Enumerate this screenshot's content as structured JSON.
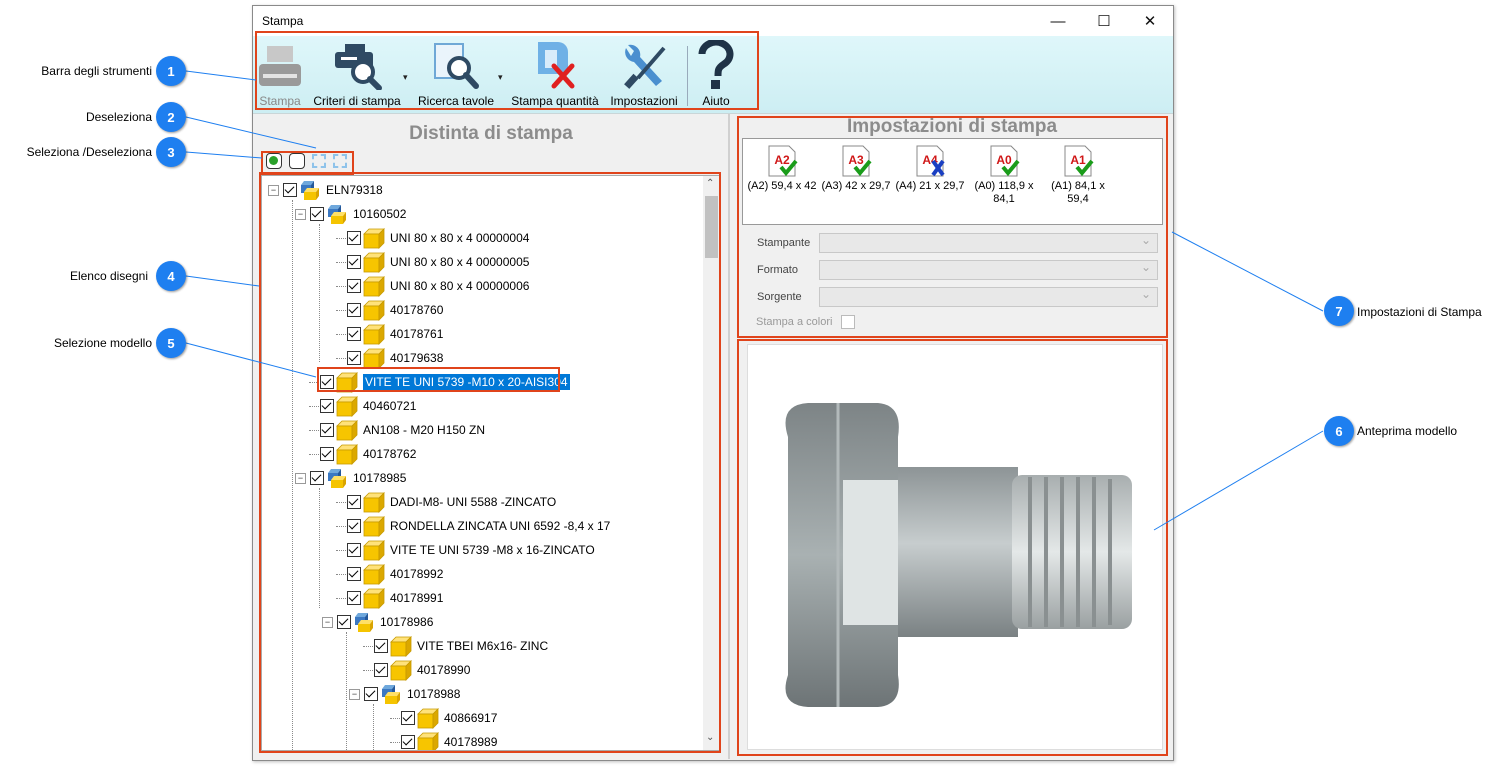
{
  "window": {
    "title": "Stampa",
    "minimize": "—",
    "maximize": "☐",
    "close": "✕"
  },
  "toolbar": {
    "print_label": "Stampa",
    "criteria_label": "Criteri di stampa",
    "search_label": "Ricerca tavole",
    "quantity_label": "Stampa quantità",
    "settings_label": "Impostazioni",
    "help_label": "Aiuto",
    "caret": "▾"
  },
  "left_panel": {
    "title": "Distinta di stampa"
  },
  "tree": {
    "items": [
      {
        "label": "ELN79318",
        "level": 0,
        "type": "assembly",
        "expander": "−"
      },
      {
        "label": "10160502",
        "level": 1,
        "type": "assembly",
        "expander": "−"
      },
      {
        "label": "UNI 80 x 80 x 4 00000004",
        "level": 2,
        "type": "part"
      },
      {
        "label": "UNI 80 x 80 x 4 00000005",
        "level": 2,
        "type": "part"
      },
      {
        "label": "UNI 80 x 80 x 4 00000006",
        "level": 2,
        "type": "part"
      },
      {
        "label": "40178760",
        "level": 2,
        "type": "part"
      },
      {
        "label": "40178761",
        "level": 2,
        "type": "part"
      },
      {
        "label": "40179638",
        "level": 2,
        "type": "part"
      },
      {
        "label": "VITE TE UNI 5739 -M10 x 20-AISI304",
        "level": 1,
        "type": "part",
        "selected": true
      },
      {
        "label": "40460721",
        "level": 1,
        "type": "part"
      },
      {
        "label": "AN108 - M20 H150 ZN",
        "level": 1,
        "type": "part"
      },
      {
        "label": "40178762",
        "level": 1,
        "type": "part"
      },
      {
        "label": "10178985",
        "level": 1,
        "type": "assembly",
        "expander": "−"
      },
      {
        "label": "DADI-M8- UNI 5588 -ZINCATO",
        "level": 2,
        "type": "part"
      },
      {
        "label": "RONDELLA ZINCATA UNI 6592 -8,4 x 17",
        "level": 2,
        "type": "part"
      },
      {
        "label": "VITE TE UNI 5739 -M8 x 16-ZINCATO",
        "level": 2,
        "type": "part"
      },
      {
        "label": "40178992",
        "level": 2,
        "type": "part"
      },
      {
        "label": "40178991",
        "level": 2,
        "type": "part"
      },
      {
        "label": "10178986",
        "level": 2,
        "type": "assembly",
        "expander": "−"
      },
      {
        "label": "VITE TBEI  M6x16- ZINC",
        "level": 3,
        "type": "part"
      },
      {
        "label": "40178990",
        "level": 3,
        "type": "part"
      },
      {
        "label": "10178988",
        "level": 3,
        "type": "assembly",
        "expander": "−"
      },
      {
        "label": "40866917",
        "level": 4,
        "type": "part"
      },
      {
        "label": "40178989",
        "level": 4,
        "type": "part"
      }
    ]
  },
  "right_panel": {
    "title": "Impostazioni di stampa",
    "formats": [
      {
        "code": "A2",
        "label": "(A2) 59,4 x 42",
        "status": "check"
      },
      {
        "code": "A3",
        "label": "(A3) 42 x 29,7",
        "status": "check"
      },
      {
        "code": "A4",
        "label": "(A4) 21 x 29,7",
        "status": "cross"
      },
      {
        "code": "A0",
        "label": "(A0) 118,9 x 84,1",
        "status": "check"
      },
      {
        "code": "A1",
        "label": "(A1) 84,1 x 59,4",
        "status": "check"
      }
    ],
    "printer_label": "Stampante",
    "format_label": "Formato",
    "source_label": "Sorgente",
    "color_label": "Stampa a colori"
  },
  "callouts": [
    {
      "num": "1",
      "text": "Barra degli strumenti"
    },
    {
      "num": "2",
      "text": "Deseleziona"
    },
    {
      "num": "3",
      "text": "Seleziona  /Deseleziona"
    },
    {
      "num": "4",
      "text": "Elenco disegni"
    },
    {
      "num": "5",
      "text": "Selezione modello"
    },
    {
      "num": "6",
      "text": "Anteprima modello"
    },
    {
      "num": "7",
      "text": "Impostazioni di Stampa"
    }
  ],
  "colors": {
    "accent": "#e0441b",
    "badge": "#1e7ff0",
    "selection": "#0078d7",
    "toolbar": "#d6f3f7"
  }
}
